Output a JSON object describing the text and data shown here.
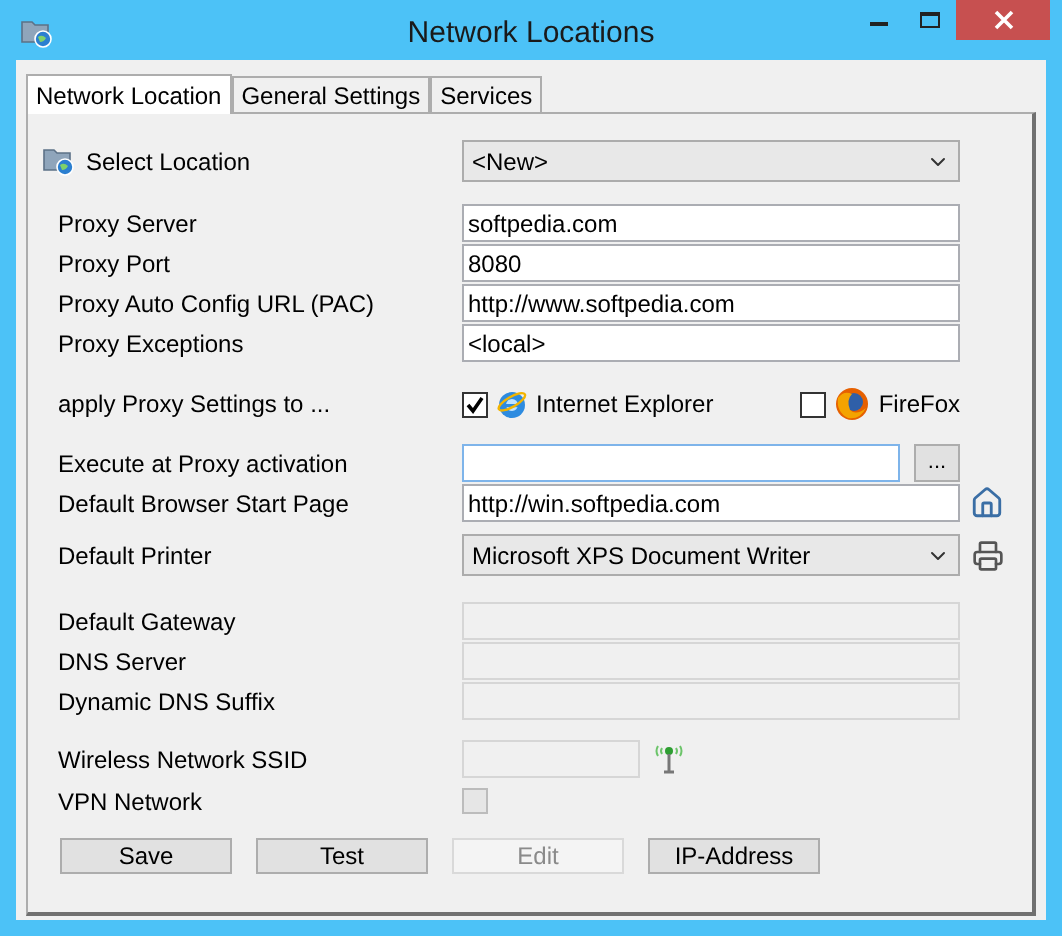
{
  "window": {
    "title": "Network Locations"
  },
  "tabs": [
    {
      "label": "Network Location",
      "selected": true
    },
    {
      "label": "General Settings",
      "selected": false
    },
    {
      "label": "Services",
      "selected": false
    }
  ],
  "select_location": {
    "label": "Select Location",
    "value": "<New>"
  },
  "proxy_fields": [
    {
      "label": "Proxy Server",
      "value": "softpedia.com"
    },
    {
      "label": "Proxy Port",
      "value": "8080"
    },
    {
      "label": "Proxy Auto Config URL (PAC)",
      "value": "http://www.softpedia.com"
    },
    {
      "label": "Proxy Exceptions",
      "value": "<local>"
    }
  ],
  "apply_proxy": {
    "label": "apply Proxy Settings to ...",
    "browsers": [
      {
        "kind": "ie",
        "name": "Internet Explorer",
        "checked": true
      },
      {
        "kind": "firefox",
        "name": "FireFox",
        "checked": false
      }
    ]
  },
  "execute": {
    "label": "Execute at Proxy activation",
    "button": "..."
  },
  "start_page": {
    "label": "Default Browser Start Page",
    "value": "http://win.softpedia.com"
  },
  "printer": {
    "label": "Default Printer",
    "value": "Microsoft XPS Document Writer"
  },
  "network_fields": [
    {
      "label": "Default Gateway",
      "disabled": true
    },
    {
      "label": "DNS Server",
      "disabled": true
    },
    {
      "label": "Dynamic DNS Suffix",
      "disabled": true
    }
  ],
  "ssid": {
    "label": "Wireless Network SSID",
    "disabled": true
  },
  "vpn": {
    "label": "VPN Network",
    "checked": false,
    "disabled": true
  },
  "buttons": [
    {
      "label": "Save",
      "disabled": false
    },
    {
      "label": "Test",
      "disabled": false
    },
    {
      "label": "Edit",
      "disabled": true
    },
    {
      "label": "IP-Address",
      "disabled": false
    }
  ]
}
